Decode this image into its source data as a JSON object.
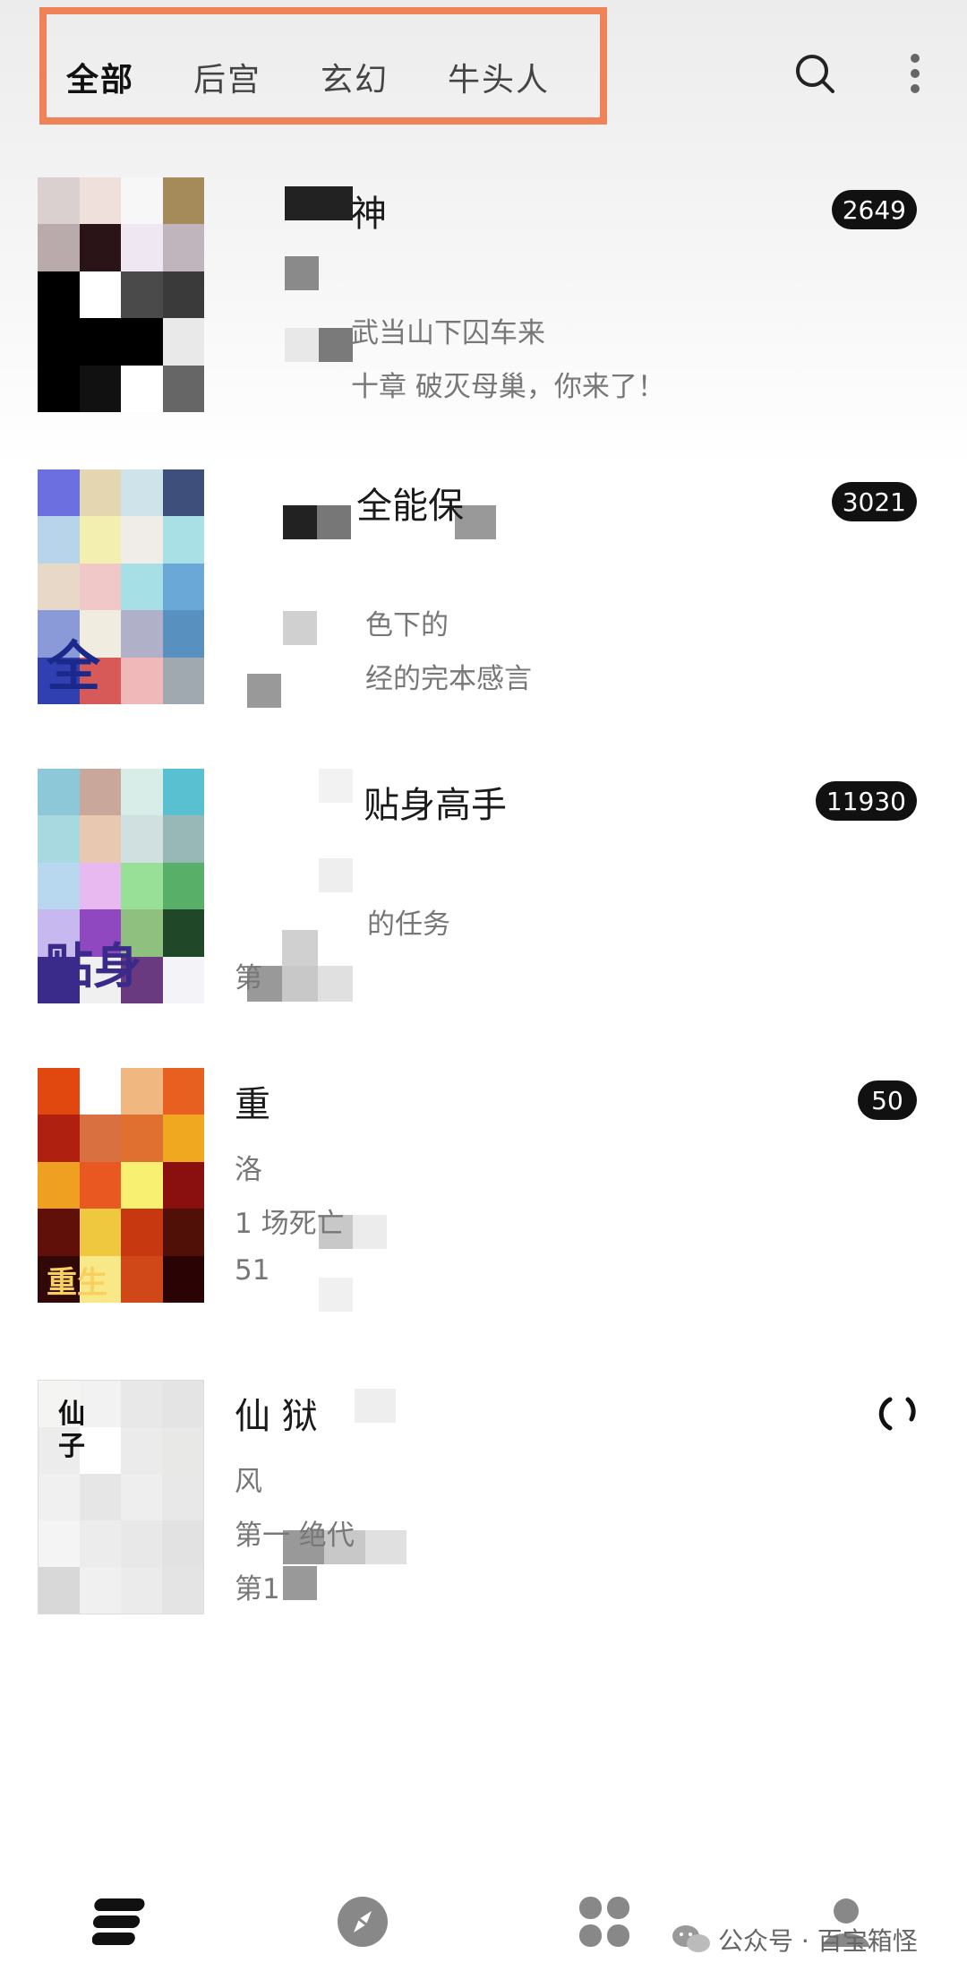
{
  "tabs": [
    "全部",
    "后宫",
    "玄幻",
    "牛头人"
  ],
  "active_tab": 0,
  "books": [
    {
      "title": "神",
      "line1": "",
      "line2": "武当山下囚车来",
      "line3": "十章 破灭母巢，你来了！",
      "badge": "2649"
    },
    {
      "title": "全能保",
      "line1": "",
      "line2": "色下的",
      "line3": "经的完本感言",
      "badge": "3021"
    },
    {
      "title": "贴身高手",
      "line1": "",
      "line2": "的任务",
      "line3": "第",
      "badge": "11930"
    },
    {
      "title": "重",
      "line1": "洛",
      "line2": "1 场死亡",
      "line3": "51",
      "badge": "50"
    },
    {
      "title": "仙 狱",
      "line1": "风",
      "line2": "第一 绝代",
      "line3": "第1",
      "badge": ""
    }
  ],
  "cover_text": {
    "book2": "全",
    "book3": "贴身",
    "book4": "重生",
    "book5": "仙子"
  },
  "watermark": "公众号 · 百宝箱怪",
  "icons": {
    "search": "search-icon",
    "more": "more-vertical-icon",
    "nav": [
      "bookshelf-icon",
      "compass-icon",
      "apps-icon",
      "profile-icon"
    ],
    "wechat": "wechat-icon"
  },
  "colors": {
    "highlight": "#f08257",
    "badge_bg": "#111111"
  }
}
